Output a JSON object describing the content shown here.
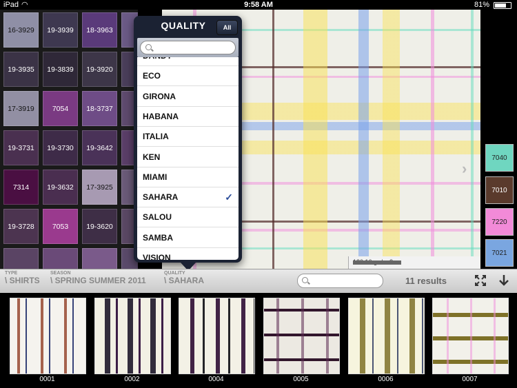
{
  "status": {
    "carrier": "iPad",
    "time": "9:58 AM",
    "battery": "81%",
    "battery_level": 0.81
  },
  "swatches": [
    {
      "label": "16-3929",
      "color": "#8f8fa6",
      "text": "#111"
    },
    {
      "label": "19-3939",
      "color": "#3e3850",
      "text": "#fff"
    },
    {
      "label": "18-3963",
      "color": "#5a3a7a",
      "text": "#fff"
    },
    {
      "label": "",
      "color": "#6b5a86",
      "text": "#fff"
    },
    {
      "label": "19-3935",
      "color": "#3b3346",
      "text": "#fff"
    },
    {
      "label": "19-3839",
      "color": "#2f2838",
      "text": "#fff"
    },
    {
      "label": "19-3920",
      "color": "#3d3648",
      "text": "#fff"
    },
    {
      "label": "",
      "color": "#4a3e5a",
      "text": "#fff"
    },
    {
      "label": "17-3919",
      "color": "#928fa3",
      "text": "#111"
    },
    {
      "label": "7054",
      "color": "#7a3a82",
      "text": "#fff"
    },
    {
      "label": "18-3737",
      "color": "#6e4c86",
      "text": "#fff"
    },
    {
      "label": "",
      "color": "#5e4a6e",
      "text": "#fff"
    },
    {
      "label": "19-3731",
      "color": "#4a3050",
      "text": "#fff"
    },
    {
      "label": "19-3730",
      "color": "#3e2b48",
      "text": "#fff"
    },
    {
      "label": "19-3642",
      "color": "#4a3258",
      "text": "#fff"
    },
    {
      "label": "",
      "color": "#5a3e68",
      "text": "#fff"
    },
    {
      "label": "7314",
      "color": "#4a0f42",
      "text": "#fff"
    },
    {
      "label": "19-3632",
      "color": "#4a2e50",
      "text": "#fff"
    },
    {
      "label": "17-3925",
      "color": "#a79ab2",
      "text": "#111"
    },
    {
      "label": "",
      "color": "#6a5a78",
      "text": "#fff"
    },
    {
      "label": "19-3728",
      "color": "#4c3450",
      "text": "#fff"
    },
    {
      "label": "7053",
      "color": "#9a3a8e",
      "text": "#fff"
    },
    {
      "label": "19-3620",
      "color": "#3e2e46",
      "text": "#fff"
    },
    {
      "label": "",
      "color": "#5a4864",
      "text": "#fff"
    },
    {
      "label": "",
      "color": "#5a4464",
      "text": "#fff"
    },
    {
      "label": "",
      "color": "#6a4a78",
      "text": "#fff"
    },
    {
      "label": "",
      "color": "#7a5a8a",
      "text": "#fff"
    },
    {
      "label": "",
      "color": "#5a4a6a",
      "text": "#fff"
    }
  ],
  "popover": {
    "title": "QUALITY",
    "all_button": "All",
    "items": [
      "DANDY",
      "ECO",
      "GIRONA",
      "HABANA",
      "ITALIA",
      "KEN",
      "MIAMI",
      "SAHARA",
      "SALOU",
      "SAMBA",
      "VISION"
    ],
    "selected": "SAHARA",
    "check": "✓"
  },
  "fabric_info": {
    "weight": "130.16 gr / m2"
  },
  "color_chips": [
    {
      "label": "7040",
      "color": "#6fd6c0",
      "text": "#222"
    },
    {
      "label": "7010",
      "color": "#5a3a2c",
      "text": "#fff"
    },
    {
      "label": "7220",
      "color": "#f28ad8",
      "text": "#222"
    },
    {
      "label": "7021",
      "color": "#7aa6e0",
      "text": "#222"
    }
  ],
  "filters": {
    "type_label": "TYPE",
    "type_value": "\\ SHIRTS",
    "season_label": "SEASON",
    "season_value": "\\ SPRING SUMMER 2011",
    "quality_label": "QUALITY",
    "quality_value": "\\ SAHARA"
  },
  "results": "11 results",
  "thumbnails": [
    {
      "label": "0001"
    },
    {
      "label": "0002"
    },
    {
      "label": "0004"
    },
    {
      "label": "0005"
    },
    {
      "label": "0006"
    },
    {
      "label": "0007"
    }
  ]
}
